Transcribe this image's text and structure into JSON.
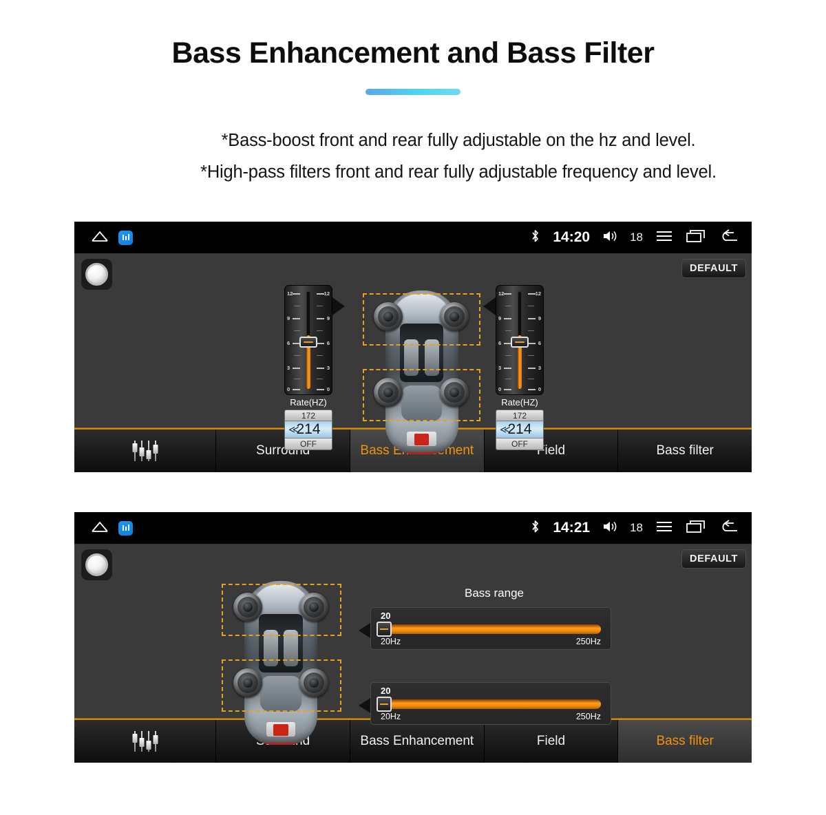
{
  "header": {
    "title": "Bass Enhancement and Bass Filter",
    "bullets": [
      "*Bass-boost front and rear fully adjustable on the hz and level.",
      "*High-pass filters front and rear fully adjustable frequency and level."
    ],
    "accent_color": "#4fd4ef"
  },
  "screenshot_1": {
    "statusbar": {
      "home_icon": "home-icon",
      "app_icon": "equalizer-app-icon",
      "bluetooth_icon": "bluetooth-icon",
      "time": "14:20",
      "volume_icon": "volume-icon",
      "volume_level": "18",
      "menu_icon": "menu-icon",
      "recents_icon": "recents-icon",
      "back_icon": "back-icon"
    },
    "knob_button": "knob-button",
    "default_button": "DEFAULT",
    "sliders": [
      {
        "name": "front-rate-slider",
        "caption": "Rate(HZ)",
        "scale_labels": [
          "12",
          "9",
          "6",
          "3",
          "0"
        ],
        "scale_min": 0,
        "scale_max": 12,
        "handle_value": 7,
        "value_prev": "172",
        "value_current": "214",
        "value_state": "OFF"
      },
      {
        "name": "rear-rate-slider",
        "caption": "Rate(HZ)",
        "scale_labels": [
          "12",
          "9",
          "6",
          "3",
          "0"
        ],
        "scale_min": 0,
        "scale_max": 12,
        "handle_value": 7,
        "value_prev": "172",
        "value_current": "214",
        "value_state": "OFF"
      }
    ],
    "car": {
      "front_zone_selected": true,
      "rear_zone_selected": true,
      "speakers": 4
    },
    "tabs": [
      {
        "label": "",
        "icon": "equalizer-icon",
        "active": false
      },
      {
        "label": "Surround",
        "active": false
      },
      {
        "label": "Bass Enhancement",
        "active": true
      },
      {
        "label": "Field",
        "active": false
      },
      {
        "label": "Bass filter",
        "active": false
      }
    ],
    "active_tab_color": "#f0920f"
  },
  "screenshot_2": {
    "statusbar": {
      "home_icon": "home-icon",
      "app_icon": "equalizer-app-icon",
      "bluetooth_icon": "bluetooth-icon",
      "time": "14:21",
      "volume_icon": "volume-icon",
      "volume_level": "18",
      "menu_icon": "menu-icon",
      "recents_icon": "recents-icon",
      "back_icon": "back-icon"
    },
    "knob_button": "knob-button",
    "default_button": "DEFAULT",
    "panel_title": "Bass range",
    "range_sliders": [
      {
        "name": "front-bass-range-slider",
        "value": "20",
        "min_label": "20Hz",
        "max_label": "250Hz",
        "min": 20,
        "max": 250
      },
      {
        "name": "rear-bass-range-slider",
        "value": "20",
        "min_label": "20Hz",
        "max_label": "250Hz",
        "min": 20,
        "max": 250
      }
    ],
    "car": {
      "front_zone_selected": true,
      "rear_zone_selected": true,
      "speakers": 4
    },
    "tabs": [
      {
        "label": "",
        "icon": "equalizer-icon",
        "active": false
      },
      {
        "label": "Surround",
        "active": false
      },
      {
        "label": "Bass Enhancement",
        "active": false
      },
      {
        "label": "Field",
        "active": false
      },
      {
        "label": "Bass filter",
        "active": true
      }
    ],
    "active_tab_color": "#f0920f"
  }
}
